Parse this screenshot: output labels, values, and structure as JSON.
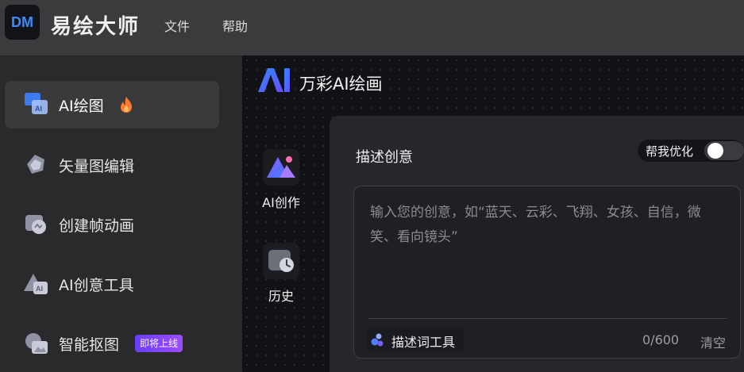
{
  "app": {
    "logo_text": "DM",
    "title": "易绘大师",
    "menu": [
      {
        "label": "文件"
      },
      {
        "label": "帮助"
      }
    ]
  },
  "sidebar": {
    "items": [
      {
        "label": "AI绘图",
        "active": true,
        "icon": "ai-image-icon",
        "extra_icon": "fire-icon"
      },
      {
        "label": "矢量图编辑",
        "active": false,
        "icon": "vector-edit-icon"
      },
      {
        "label": "创建帧动画",
        "active": false,
        "icon": "frame-animation-icon"
      },
      {
        "label": "AI创意工具",
        "active": false,
        "icon": "ai-creative-tool-icon"
      },
      {
        "label": "智能抠图",
        "active": false,
        "icon": "smart-cutout-icon",
        "badge": "即将上线"
      }
    ]
  },
  "main": {
    "brand_title": "万彩AI绘画",
    "tools": [
      {
        "label": "AI创作",
        "icon": "ai-create-icon"
      },
      {
        "label": "历史",
        "icon": "history-icon"
      }
    ],
    "panel": {
      "title": "描述创意",
      "optimize_label": "帮我优化",
      "optimize_on": false,
      "placeholder": "输入您的创意，如“蓝天、云彩、飞翔、女孩、自信，微笑、看向镜头”",
      "prompt_tool_label": "描述词工具",
      "counter": "0/600",
      "clear_label": "清空"
    }
  },
  "colors": {
    "accent": "#3d8bff",
    "badge_start": "#6a3dff",
    "badge_end": "#9b4dff",
    "fire": "#ff7a2e"
  }
}
